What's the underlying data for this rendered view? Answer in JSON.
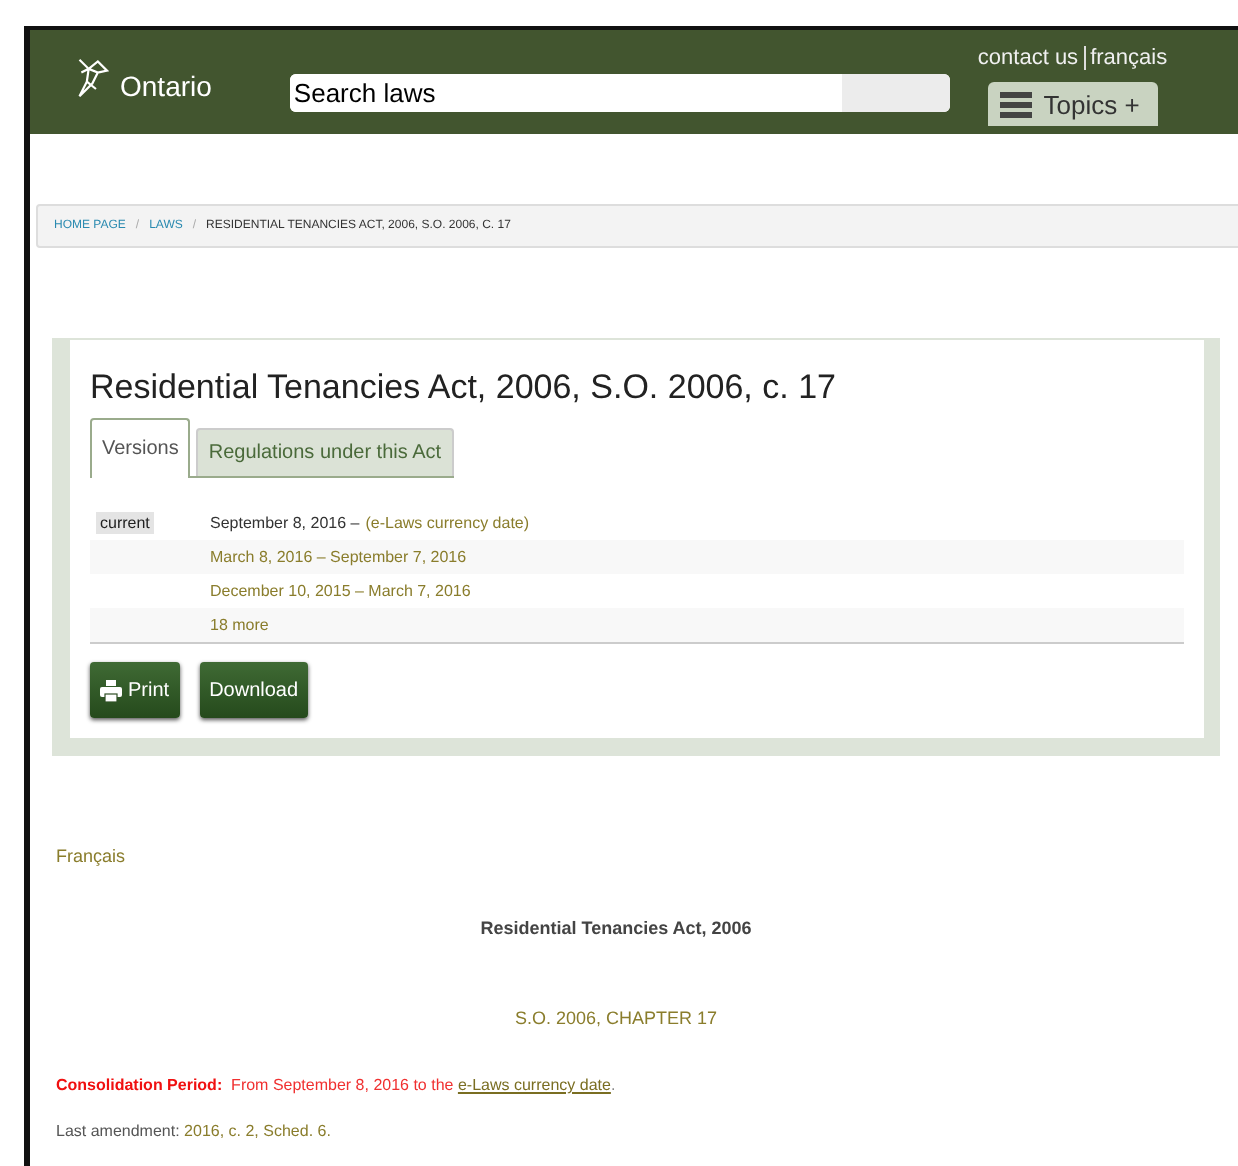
{
  "header": {
    "logo": "Ontario",
    "search": {
      "placeholder": "Search laws"
    },
    "links": [
      "contact us",
      "français"
    ],
    "topics": "Topics +"
  },
  "breadcrumb": [
    {
      "label": "HOME PAGE",
      "kind": "link"
    },
    {
      "separator": "/",
      "label": "LAWS",
      "kind": "link"
    },
    {
      "separator": "/",
      "label": "RESIDENTIAL TENANCIES ACT, 2006, S.O. 2006, C. 17",
      "kind": "current"
    }
  ],
  "act": {
    "title": "Residential Tenancies Act, 2006, S.O. 2006, c. 17",
    "tabs": [
      {
        "label": "Versions",
        "selected": true
      },
      {
        "label": "Regulations under this Act",
        "selected": false
      }
    ],
    "versions": [
      {
        "badge": "current",
        "date": "September 8, 2016 –",
        "link": "(e-Laws currency date)"
      },
      {
        "link": "March 8, 2016 – September 7, 2016"
      },
      {
        "link": "December 10, 2015 – March 7, 2016"
      },
      {
        "link": "18 more"
      }
    ],
    "buttons": [
      {
        "label": "Print",
        "kind": "print"
      },
      {
        "label": "Download",
        "kind": "download"
      }
    ]
  },
  "body": {
    "language_link": "Français",
    "heading": "Residential Tenancies Act, 2006",
    "chapter": "S.O. 2006, CHAPTER 17",
    "consolidation": {
      "label": "Consolidation Period:",
      "text": "From September 8, 2016 to the",
      "link": "e-Laws currency date",
      "end": "."
    },
    "amendment": {
      "label": "Last amendment:",
      "link": "2016, c. 2, Sched. 6."
    }
  }
}
